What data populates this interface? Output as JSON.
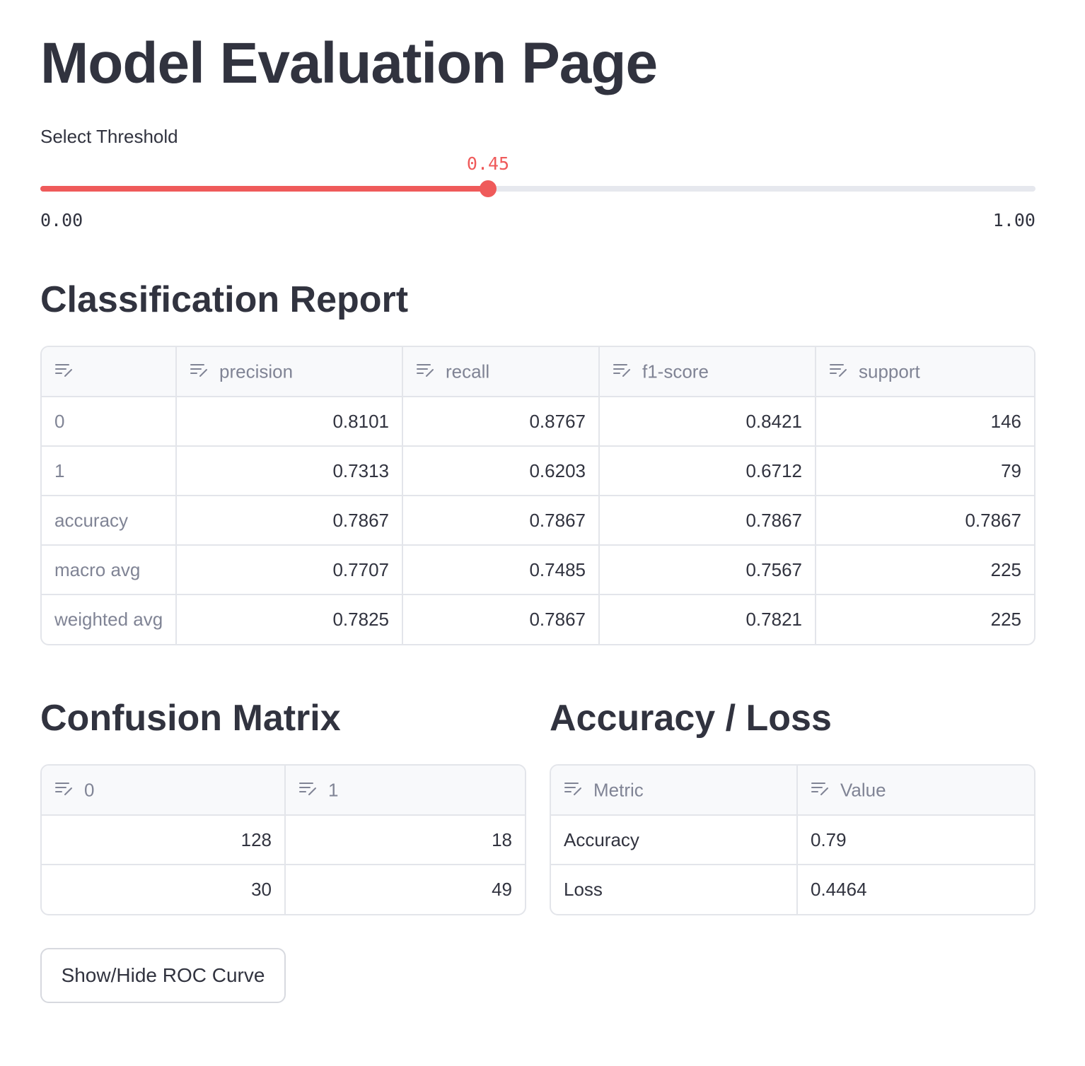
{
  "page": {
    "title": "Model Evaluation Page"
  },
  "threshold": {
    "label": "Select Threshold",
    "value": 0.45,
    "value_text": "0.45",
    "min_text": "0.00",
    "max_text": "1.00",
    "min": 0,
    "max": 1,
    "accent": "#ef5a5a"
  },
  "classification": {
    "heading": "Classification Report",
    "columns": [
      "",
      "precision",
      "recall",
      "f1-score",
      "support"
    ],
    "rows": [
      [
        "0",
        "0.8101",
        "0.8767",
        "0.8421",
        "146"
      ],
      [
        "1",
        "0.7313",
        "0.6203",
        "0.6712",
        "79"
      ],
      [
        "accuracy",
        "0.7867",
        "0.7867",
        "0.7867",
        "0.7867"
      ],
      [
        "macro avg",
        "0.7707",
        "0.7485",
        "0.7567",
        "225"
      ],
      [
        "weighted avg",
        "0.7825",
        "0.7867",
        "0.7821",
        "225"
      ]
    ]
  },
  "confusion": {
    "heading": "Confusion Matrix",
    "columns": [
      "0",
      "1"
    ],
    "rows": [
      [
        "128",
        "18"
      ],
      [
        "30",
        "49"
      ]
    ]
  },
  "accuracy_loss": {
    "heading": "Accuracy / Loss",
    "columns": [
      "Metric",
      "Value"
    ],
    "rows": [
      [
        "Accuracy",
        "0.79"
      ],
      [
        "Loss",
        "0.4464"
      ]
    ]
  },
  "roc_button": {
    "label": "Show/Hide ROC Curve"
  },
  "icons": {
    "column_header": "edit-column-icon"
  }
}
